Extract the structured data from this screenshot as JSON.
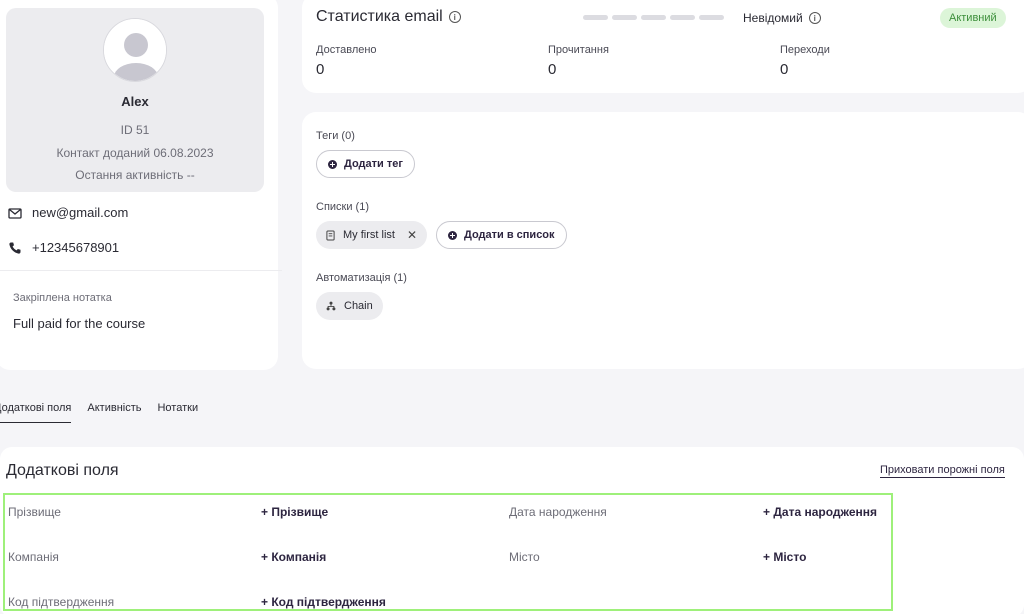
{
  "profile": {
    "name": "Alex",
    "id_text": "ID 51",
    "added_text": "Контакт доданий 06.08.2023",
    "last_activity_text": "Остання активність --",
    "email": "new@gmail.com",
    "phone": "+12345678901",
    "pinned_note_title": "Закріплена нотатка",
    "pinned_note_text": "Full paid for the course"
  },
  "email_stats": {
    "title": "Статистика email",
    "status_text": "Невідомий",
    "badge": "Активний",
    "delivered_label": "Доставлено",
    "delivered_value": "0",
    "reads_label": "Прочитання",
    "reads_value": "0",
    "clicks_label": "Переходи",
    "clicks_value": "0"
  },
  "tags": {
    "tags_label": "Теги (0)",
    "add_tag": "Додати тег",
    "lists_label": "Списки (1)",
    "list_item": "My first list",
    "add_to_list": "Додати в список",
    "automation_label": "Автоматизація (1)",
    "automation_item": "Chain"
  },
  "tabs": [
    "Додаткові поля",
    "Активність",
    "Нотатки"
  ],
  "fields": {
    "title": "Додаткові поля",
    "hide_empty": "Приховати порожні поля",
    "surname_label": "Прізвище",
    "surname_add": "+ Прізвище",
    "birthdate_label": "Дата народження",
    "birthdate_add": "+ Дата народження",
    "company_label": "Компанія",
    "company_add": "+ Компанія",
    "city_label": "Місто",
    "city_add": "+ Місто",
    "code_label": "Код підтвердження",
    "code_add": "+ Код підтвердження"
  },
  "colors": {
    "accent": "#2d2540",
    "active_badge_bg": "#dcf5d8",
    "active_badge_text": "#3c8f3a",
    "highlight_border": "#9ef07a"
  }
}
